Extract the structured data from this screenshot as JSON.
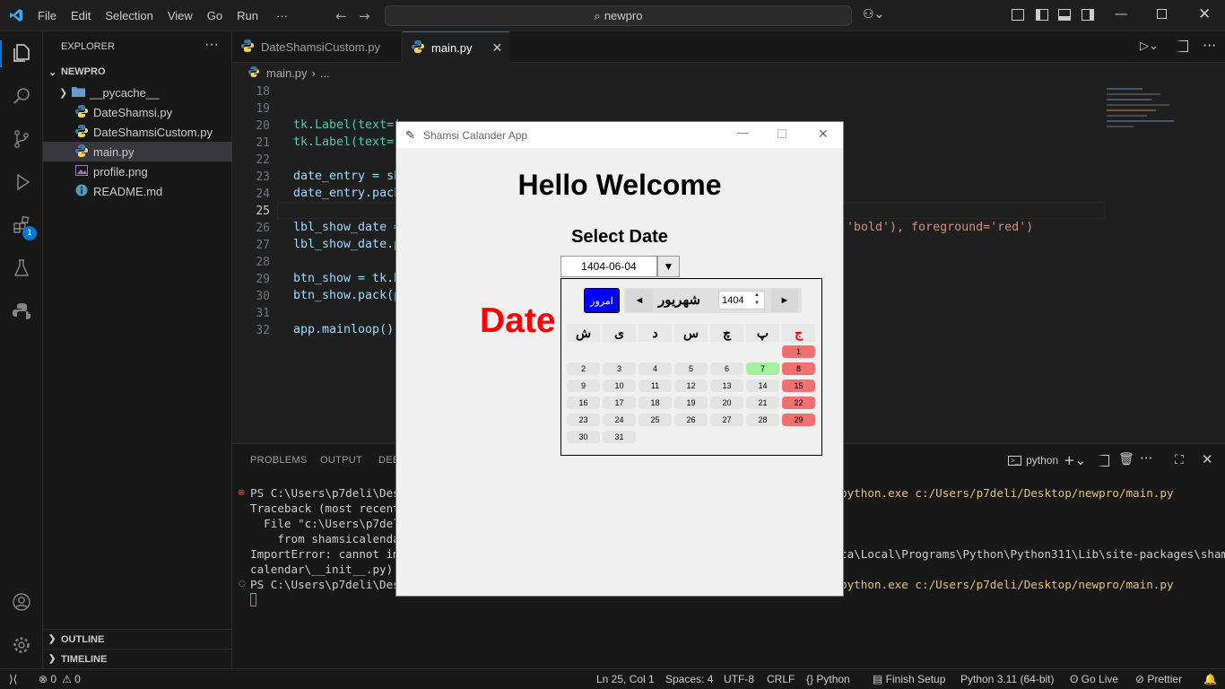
{
  "menu": [
    "File",
    "Edit",
    "Selection",
    "View",
    "Go",
    "Run",
    "···"
  ],
  "command_center": "newpro",
  "activity_badge": "1",
  "explorer": {
    "title": "EXPLORER",
    "root": "NEWPRO",
    "items": [
      "__pycache__",
      "DateShamsi.py",
      "DateShamsiCustom.py",
      "main.py",
      "profile.png",
      "README.md"
    ],
    "outline": "OUTLINE",
    "timeline": "TIMELINE"
  },
  "tabs": [
    {
      "label": "DateShamsiCustom.py"
    },
    {
      "label": "main.py"
    }
  ],
  "breadcrumb": {
    "file": "main.py",
    "rest": "..."
  },
  "code_lines": [
    {
      "num": "18",
      "text": ""
    },
    {
      "num": "19",
      "text": ""
    },
    {
      "num": "20",
      "text": "tk.Label(text='"
    },
    {
      "num": "21",
      "text": "tk.Label(text='"
    },
    {
      "num": "22",
      "text": ""
    },
    {
      "num": "23",
      "text": "date_entry = sh"
    },
    {
      "num": "24",
      "text": "date_entry.pack"
    },
    {
      "num": "25",
      "text": ""
    },
    {
      "num": "26",
      "text": "lbl_show_date ="
    },
    {
      "num": "27",
      "text": "lbl_show_date.p"
    },
    {
      "num": "28",
      "text": ""
    },
    {
      "num": "29",
      "text": "btn_show = tk.B"
    },
    {
      "num": "30",
      "text": "btn_show.pack(p"
    },
    {
      "num": "31",
      "text": ""
    },
    {
      "num": "32",
      "text": "app.mainloop()"
    }
  ],
  "code_tail_26": "'bold'), foreground='red')",
  "panel": {
    "tabs": [
      "PROBLEMS",
      "OUTPUT",
      "DEB"
    ],
    "terminal_name": "python",
    "lines": [
      {
        "left": "PS C:\\Users\\p7deli\\Desk",
        "right": "python.exe c:/Users/p7deli/Desktop/newpro/main.py"
      },
      {
        "left": "Traceback (most recent",
        "right": ""
      },
      {
        "left": "  File \"c:\\Users\\p7deli",
        "right": ""
      },
      {
        "left": "    from shamsicalendar",
        "right": ""
      },
      {
        "left": "ImportError: cannot imp",
        "right": "ca\\Local\\Programs\\Python\\Python311\\Lib\\site-packages\\shamsi"
      },
      {
        "left": "calendar\\__init__.py)",
        "right": ""
      },
      {
        "left": "PS C:\\Users\\p7deli\\Desk",
        "right": "python.exe c:/Users/p7deli/Desktop/newpro/main.py"
      }
    ]
  },
  "status": {
    "errors": "0",
    "warnings": "0",
    "position": "Ln 25, Col 1",
    "spaces": "Spaces: 4",
    "encoding": "UTF-8",
    "eol": "CRLF",
    "language": "Python",
    "finish_setup": "Finish Setup",
    "interpreter": "Python 3.11 (64-bit)",
    "golive": "Go Live",
    "prettier": "Prettier"
  },
  "app": {
    "title": "Shamsi Calander App",
    "heading": "Hello Welcome",
    "select_label": "Select Date",
    "date_value": "1404-06-04",
    "date_label": "Date",
    "calendar": {
      "today_button": "امروز",
      "month": "شهریور",
      "year": "1404",
      "weekdays": [
        "ش",
        "ی",
        "د",
        "س",
        "چ",
        "پ",
        "ج"
      ],
      "rows": [
        [
          "",
          "",
          "",
          "",
          "",
          "",
          "1"
        ],
        [
          "2",
          "3",
          "4",
          "5",
          "6",
          "7",
          "8"
        ],
        [
          "9",
          "10",
          "11",
          "12",
          "13",
          "14",
          "15"
        ],
        [
          "16",
          "17",
          "18",
          "19",
          "20",
          "21",
          "22"
        ],
        [
          "23",
          "24",
          "25",
          "26",
          "27",
          "28",
          "29"
        ],
        [
          "30",
          "31",
          "",
          "",
          "",
          "",
          ""
        ]
      ],
      "selected_day": "7",
      "holiday_color": "#f07070",
      "selected_color": "#a3f0a0"
    }
  },
  "colors": {
    "accent": "#0078d4",
    "error": "#f14c4c",
    "date_red": "#ff0000",
    "today_btn": "#0000ff"
  }
}
